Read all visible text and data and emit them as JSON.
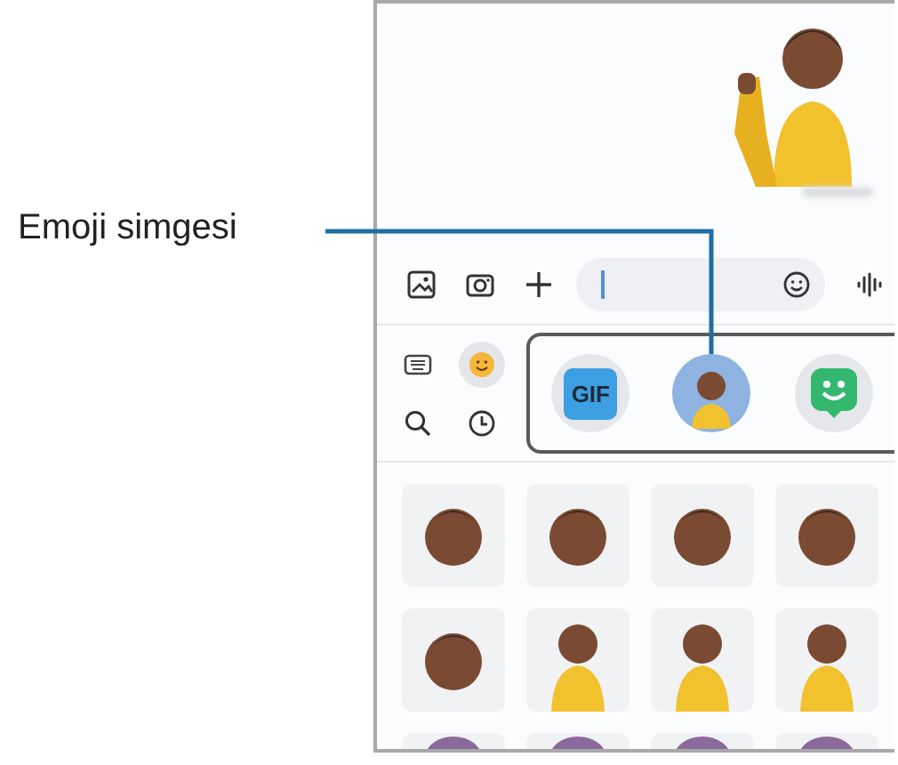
{
  "callout": {
    "label": "Emoji simgesi"
  },
  "chat": {
    "sticker_message": {
      "kind": "waving"
    }
  },
  "input_bar": {
    "buttons": [
      {
        "kind": "gallery"
      },
      {
        "kind": "camera"
      },
      {
        "kind": "plus"
      }
    ],
    "emoji_button": {
      "kind": "smiley"
    },
    "voice_button": {
      "kind": "voice"
    }
  },
  "panel_tabs": [
    {
      "kind": "keyboard",
      "selected": false
    },
    {
      "kind": "emoji",
      "selected": true
    },
    {
      "kind": "search",
      "selected": false
    },
    {
      "kind": "recent",
      "selected": false
    }
  ],
  "categories": [
    {
      "kind": "gif",
      "label": "GIF",
      "selected": false
    },
    {
      "kind": "avatar",
      "selected": true
    },
    {
      "kind": "sticker",
      "selected": false
    }
  ],
  "stickers": [
    {
      "kind": "face"
    },
    {
      "kind": "face"
    },
    {
      "kind": "face"
    },
    {
      "kind": "face"
    },
    {
      "kind": "face"
    },
    {
      "kind": "figure"
    },
    {
      "kind": "figure"
    },
    {
      "kind": "figure"
    },
    {
      "kind": "cut"
    },
    {
      "kind": "cut"
    },
    {
      "kind": "cut"
    },
    {
      "kind": "cut"
    }
  ]
}
